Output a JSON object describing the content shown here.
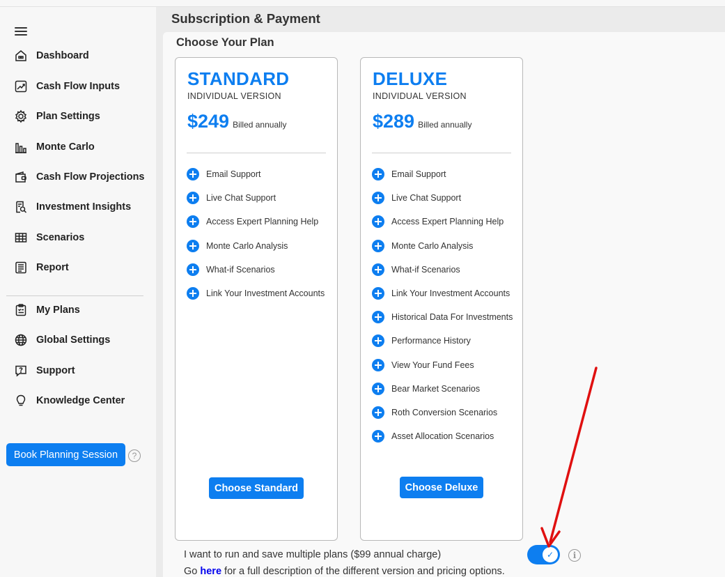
{
  "header": {
    "title": "Subscription & Payment"
  },
  "sidebar": {
    "items": [
      {
        "label": "Dashboard",
        "icon": "dashboard-icon"
      },
      {
        "label": "Cash Flow Inputs",
        "icon": "chart-trend-icon"
      },
      {
        "label": "Plan Settings",
        "icon": "gear-icon"
      },
      {
        "label": "Monte Carlo",
        "icon": "bar-chart-icon"
      },
      {
        "label": "Cash Flow Projections",
        "icon": "wallet-icon"
      },
      {
        "label": "Investment Insights",
        "icon": "magnifier-report-icon"
      },
      {
        "label": "Scenarios",
        "icon": "table-icon"
      },
      {
        "label": "Report",
        "icon": "report-icon"
      }
    ],
    "secondary_items": [
      {
        "label": "My Plans",
        "icon": "clipboard-icon"
      },
      {
        "label": "Global Settings",
        "icon": "globe-icon"
      },
      {
        "label": "Support",
        "icon": "chat-question-icon"
      },
      {
        "label": "Knowledge Center",
        "icon": "lightbulb-icon"
      }
    ],
    "book_button": "Book Planning Session",
    "help_glyph": "?"
  },
  "main": {
    "section_title": "Choose Your Plan",
    "plans": [
      {
        "name": "STANDARD",
        "version": "INDIVIDUAL VERSION",
        "price": "$249",
        "billing": "Billed annually",
        "features": [
          "Email Support",
          "Live Chat Support",
          "Access Expert Planning Help",
          "Monte Carlo Analysis",
          "What-if Scenarios",
          "Link Your Investment Accounts"
        ],
        "button": "Choose Standard"
      },
      {
        "name": "DELUXE",
        "version": "INDIVIDUAL VERSION",
        "price": "$289",
        "billing": "Billed annually",
        "features": [
          "Email Support",
          "Live Chat Support",
          "Access Expert Planning Help",
          "Monte Carlo Analysis",
          "What-if Scenarios",
          "Link Your Investment Accounts",
          "Historical Data For Investments",
          "Performance History",
          "View Your Fund Fees",
          "Bear Market Scenarios",
          "Roth Conversion Scenarios",
          "Asset Allocation Scenarios"
        ],
        "button": "Choose Deluxe"
      }
    ],
    "multi_plan_label": "I want to run and save multiple plans ($99 annual charge)",
    "multi_plan_enabled": true,
    "toggle_check": "✓",
    "info_glyph": "i",
    "footer_prefix": "Go",
    "footer_link": "here",
    "footer_suffix": "for a full description of the different version and pricing options."
  },
  "colors": {
    "accent": "#0d7ef0",
    "annotation_arrow": "#e01010"
  }
}
